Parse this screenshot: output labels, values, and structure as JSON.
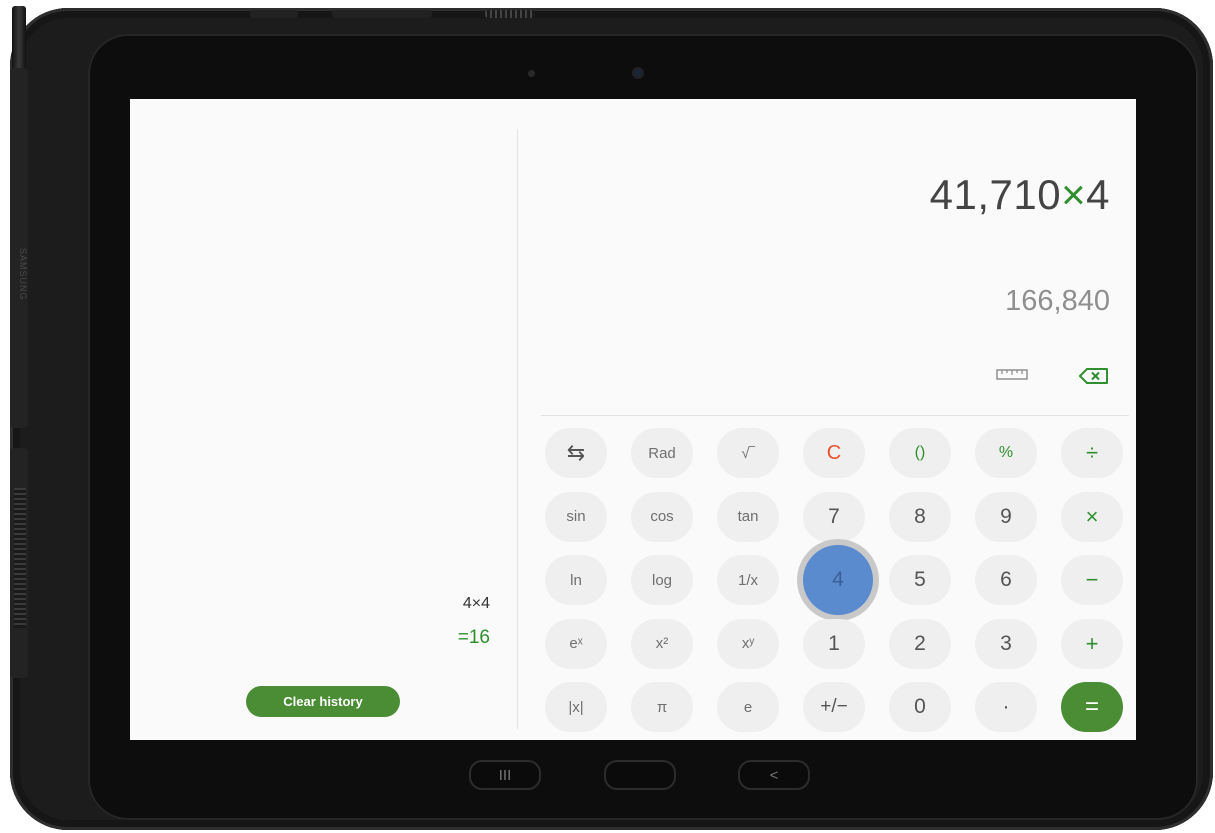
{
  "device": {
    "brand_text": "SAMSUNG"
  },
  "history": {
    "entries": [
      {
        "expression": "4×4",
        "result": "=16"
      }
    ],
    "clear_label": "Clear history"
  },
  "display": {
    "expression_prefix": "41,710",
    "expression_operator": "×",
    "expression_suffix": "4",
    "result": "166,840"
  },
  "keypad": {
    "rows": [
      [
        "⇆",
        "Rad",
        "√‾",
        "C",
        "()",
        "%",
        "÷"
      ],
      [
        "sin",
        "cos",
        "tan",
        "7",
        "8",
        "9",
        "×"
      ],
      [
        "ln",
        "log",
        "1/x",
        "4",
        "5",
        "6",
        "−"
      ],
      [
        "eˣ",
        "x²",
        "xʸ",
        "1",
        "2",
        "3",
        "+"
      ],
      [
        "|x|",
        "π",
        "e",
        "+/−",
        "0",
        "·",
        "="
      ]
    ],
    "pressed_key": "4"
  },
  "navigation": {
    "recents": "III",
    "home": "",
    "back": "<"
  },
  "colors": {
    "accent_green": "#4a8d35",
    "operator_green": "#2f8f2f",
    "clear_red": "#e8532b",
    "pressed_blue": "#5b8bcf"
  }
}
